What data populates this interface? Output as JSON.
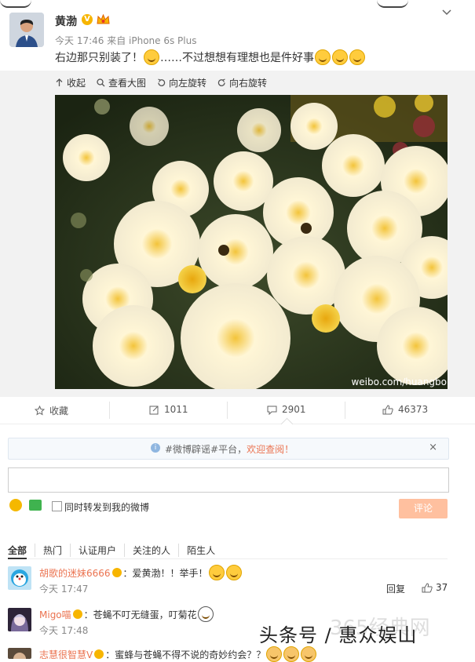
{
  "post": {
    "username": "黄渤",
    "vip_badge": "V",
    "meta": "今天 17:46 来自 iPhone 6s Plus",
    "text_part1": "右边那只别装了！",
    "text_part2": "……不过想想有理想也是件好事"
  },
  "media_tools": [
    {
      "icon": "collapse-icon",
      "label": "收起"
    },
    {
      "icon": "zoom-icon",
      "label": "查看大图"
    },
    {
      "icon": "rotate-left-icon",
      "label": "向左旋转"
    },
    {
      "icon": "rotate-right-icon",
      "label": "向右旋转"
    }
  ],
  "photo": {
    "watermark": "weibo.com/huangbo"
  },
  "actions": {
    "favorite": "收藏",
    "repost": "1011",
    "comment": "2901",
    "like": "46373"
  },
  "notice": {
    "text": "#微博辟谣#平台，",
    "link": "欢迎查阅！",
    "close": "×"
  },
  "composer": {
    "placeholder": "",
    "repost_label": "同时转发到我的微博",
    "submit_label": "评论"
  },
  "filters": [
    "全部",
    "热门",
    "认证用户",
    "关注的人",
    "陌生人"
  ],
  "comments": [
    {
      "name": "胡歌的迷妹6666",
      "text": "：爱黄渤！！举手！",
      "time": "今天 17:47",
      "reply": "回复",
      "likes": "37"
    },
    {
      "name": "Migo喵",
      "text": "：苍蝇不叮无缝蛋，叮菊花",
      "time": "今天 17:48",
      "reply": "",
      "likes": ""
    },
    {
      "name": "志慧很智慧V",
      "text": "：蜜蜂与苍蝇不得不说的奇妙约会？？",
      "time": "",
      "reply": "",
      "likes": ""
    }
  ],
  "overlay": {
    "text": "头条号 / 惠众娱山",
    "ghost": "365经典网"
  },
  "colors": {
    "accent": "#eb7350",
    "submit_bg": "#ffc09f",
    "panel_bg": "#f2f2f2",
    "vip": "#f7b500"
  }
}
